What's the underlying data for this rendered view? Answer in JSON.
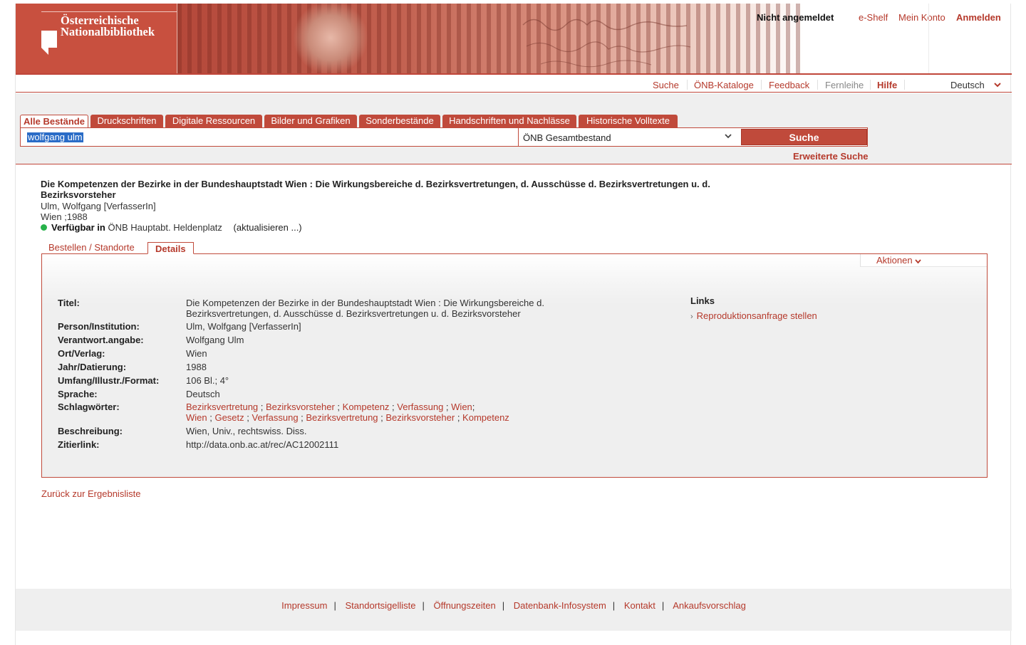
{
  "logo": {
    "line1": "Österreichische",
    "line2": "Nationalbibliothek"
  },
  "user": {
    "status": "Nicht angemeldet",
    "eshelf": "e-Shelf",
    "account": "Mein Konto",
    "login": "Anmelden"
  },
  "nav": {
    "items": [
      "Suche",
      "ÖNB-Kataloge",
      "Feedback",
      "Fernleihe",
      "Hilfe"
    ],
    "language": "Deutsch"
  },
  "search": {
    "tabs": [
      "Alle Bestände",
      "Druckschriften",
      "Digitale Ressourcen",
      "Bilder und Grafiken",
      "Sonderbestände",
      "Handschriften und Nachlässe",
      "Historische Volltexte"
    ],
    "query": "wolfgang ulm",
    "scope": "ÖNB Gesamtbestand",
    "button": "Suche",
    "advanced": "Erweiterte Suche"
  },
  "record": {
    "title": "Die Kompetenzen der Bezirke in der Bundeshauptstadt Wien : Die Wirkungsbereiche d. Bezirksvertretungen, d. Ausschüsse d. Bezirksvertretungen u. d. Bezirksvorsteher",
    "author": "Ulm, Wolfgang [VerfasserIn]",
    "pubinfo": "Wien ;1988",
    "availability_label": "Verfügbar in",
    "availability_location": "ÖNB Hauptabt. Heldenplatz",
    "refresh": "(aktualisieren ...)"
  },
  "detail_tabs": {
    "order": "Bestellen / Standorte",
    "details": "Details"
  },
  "actions_label": "Aktionen",
  "details": {
    "labels": {
      "title": "Titel:",
      "person": "Person/Institution:",
      "responsibility": "Verantwort.angabe:",
      "place": "Ort/Verlag:",
      "year": "Jahr/Datierung:",
      "extent": "Umfang/Illustr./Format:",
      "language": "Sprache:",
      "subjects": "Schlagwörter:",
      "description": "Beschreibung:",
      "citelink": "Zitierlink:"
    },
    "values": {
      "title_line1": "Die Kompetenzen der Bezirke in der Bundeshauptstadt Wien : Die Wirkungsbereiche d.",
      "title_line2": "Bezirksvertretungen, d. Ausschüsse d. Bezirksvertretungen u. d. Bezirksvorsteher",
      "person": "Ulm, Wolfgang [VerfasserIn]",
      "responsibility": "Wolfgang Ulm",
      "place": "Wien",
      "year": "1988",
      "extent": "106 Bl.; 4°",
      "language": "Deutsch",
      "subjects_row1": [
        "Bezirksvertretung",
        "Bezirksvorsteher",
        "Kompetenz",
        "Verfassung",
        "Wien"
      ],
      "subjects_row2": [
        "Wien",
        "Gesetz",
        "Verfassung",
        "Bezirksvertretung",
        "Bezirksvorsteher",
        "Kompetenz"
      ],
      "description": "Wien, Univ., rechtswiss. Diss.",
      "citelink": "http://data.onb.ac.at/rec/AC12002111"
    }
  },
  "links": {
    "title": "Links",
    "item": "Reproduktionsanfrage stellen"
  },
  "back": "Zurück zur Ergebnisliste",
  "footer": [
    "Impressum",
    "Standortsigelliste",
    "Öffnungszeiten",
    "Datenbank-Infosystem",
    "Kontakt",
    "Ankaufsvorschlag"
  ],
  "colors": {
    "brand": "#c04a3b",
    "link": "#b5392b",
    "available": "#27b24a"
  }
}
